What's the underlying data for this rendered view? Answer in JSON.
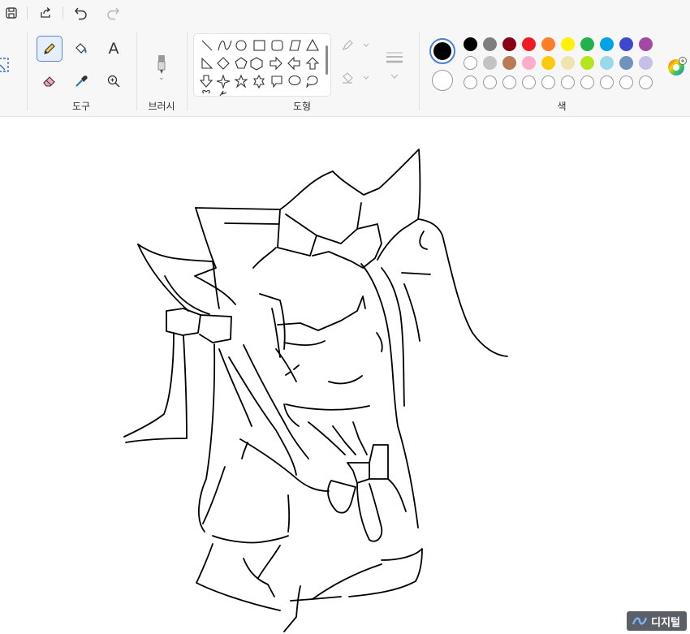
{
  "ribbon": {
    "groups": {
      "tools": "도구",
      "brushes": "브러시",
      "shapes": "도형",
      "colors": "색"
    },
    "text_tool_glyph": "A"
  },
  "colors": {
    "primary": "#000000",
    "secondary": "#ffffff",
    "palette_row1": [
      "#000000",
      "#7f7f7f",
      "#880015",
      "#ed1c24",
      "#ff7f27",
      "#fff200",
      "#22b14c",
      "#00a2e8",
      "#3f48cc",
      "#a349a4"
    ],
    "palette_row2": [
      "#ffffff",
      "#c3c3c3",
      "#b97a57",
      "#ffaec9",
      "#ffc90e",
      "#efe4b0",
      "#b5e61d",
      "#99d9ea",
      "#7092be",
      "#c8bfe7"
    ],
    "custom_slots": 10
  },
  "watermark": {
    "text": "디지털"
  }
}
